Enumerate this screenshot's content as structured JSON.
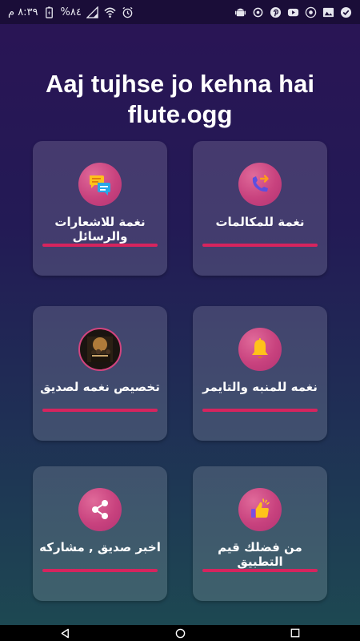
{
  "status_bar": {
    "time": "٨:٣٩ م",
    "battery": "%٨٤",
    "left_icons": [
      "battery-icon",
      "signal-icon",
      "wifi-icon",
      "alarm-icon"
    ],
    "right_icons": [
      "android-icon",
      "sync-icon",
      "pinterest-icon",
      "youtube-icon",
      "notification-icon",
      "image-icon",
      "check-icon"
    ]
  },
  "title": "Aaj tujhse jo kehna hai flute.ogg",
  "colors": {
    "accent": "#d6245e",
    "icon_circle": "#c8427e",
    "bg_top": "#2a1455",
    "bg_bottom": "#1d4a52"
  },
  "cards": [
    {
      "label": "نغمة للمكالمات",
      "icon": "call-forward-icon"
    },
    {
      "label": "نغمة للاشعارات والرسائل",
      "icon": "chat-bubbles-icon"
    },
    {
      "label": "نغمه للمنبه والتايمر",
      "icon": "bell-icon"
    },
    {
      "label": "تخصيص نغمه لصديق",
      "icon": "friend-photo-icon"
    },
    {
      "label": "من فضلك قيم التطبيق",
      "icon": "thumbs-up-icon"
    },
    {
      "label": "اخبر صديق , مشاركه",
      "icon": "share-icon"
    }
  ],
  "nav": [
    "back-icon",
    "home-icon",
    "recents-icon"
  ]
}
